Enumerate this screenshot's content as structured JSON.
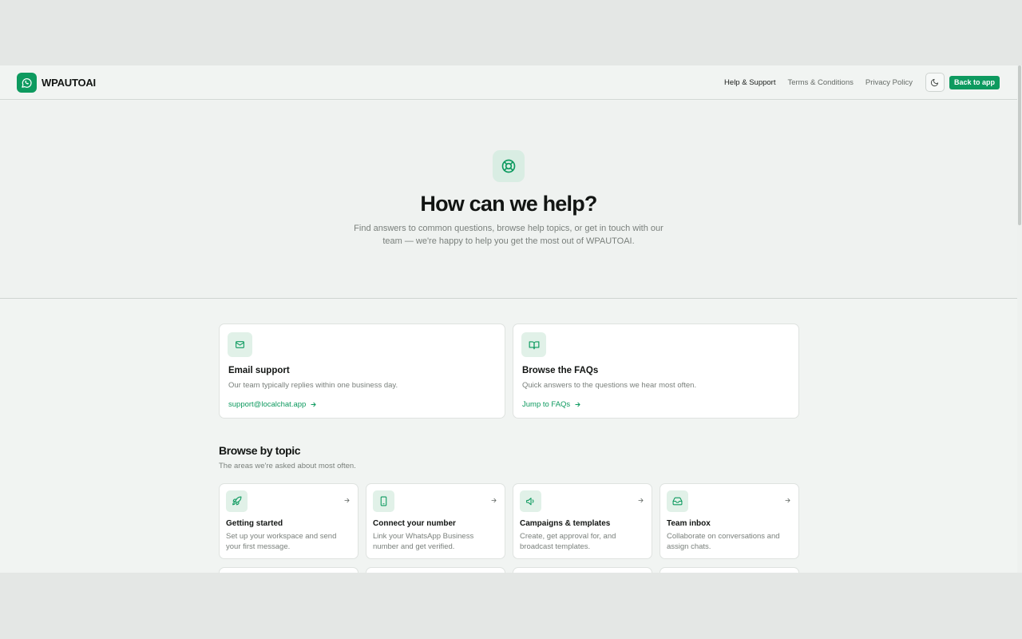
{
  "header": {
    "brand": "WPAUTOAI",
    "nav": [
      {
        "label": "Help & Support",
        "active": true
      },
      {
        "label": "Terms & Conditions",
        "active": false
      },
      {
        "label": "Privacy Policy",
        "active": false
      }
    ],
    "theme_toggle_icon": "moon-icon",
    "back_button": "Back to app"
  },
  "hero": {
    "icon": "lifebuoy-icon",
    "title": "How can we help?",
    "subtitle": "Find answers to common questions, browse help topics, or get in touch with our team — we're happy to help you get the most out of WPAUTOAI."
  },
  "contact": [
    {
      "icon": "mail-icon",
      "title": "Email support",
      "description": "Our team typically replies within one business day.",
      "link": "support@localchat.app"
    },
    {
      "icon": "book-icon",
      "title": "Browse the FAQs",
      "description": "Quick answers to the questions we hear most often.",
      "link": "Jump to FAQs"
    }
  ],
  "topics_section": {
    "title": "Browse by topic",
    "subtitle": "The areas we're asked about most often.",
    "topics": [
      {
        "icon": "rocket-icon",
        "title": "Getting started",
        "description": "Set up your workspace and send your first message."
      },
      {
        "icon": "phone-icon",
        "title": "Connect your number",
        "description": "Link your WhatsApp Business number and get verified."
      },
      {
        "icon": "megaphone-icon",
        "title": "Campaigns & templates",
        "description": "Create, get approval for, and broadcast templates."
      },
      {
        "icon": "inbox-icon",
        "title": "Team inbox",
        "description": "Collaborate on conversations and assign chats."
      }
    ]
  },
  "colors": {
    "accent": "#0d9a5f",
    "background": "#f1f4f2",
    "chip": "#e1f1e8"
  }
}
